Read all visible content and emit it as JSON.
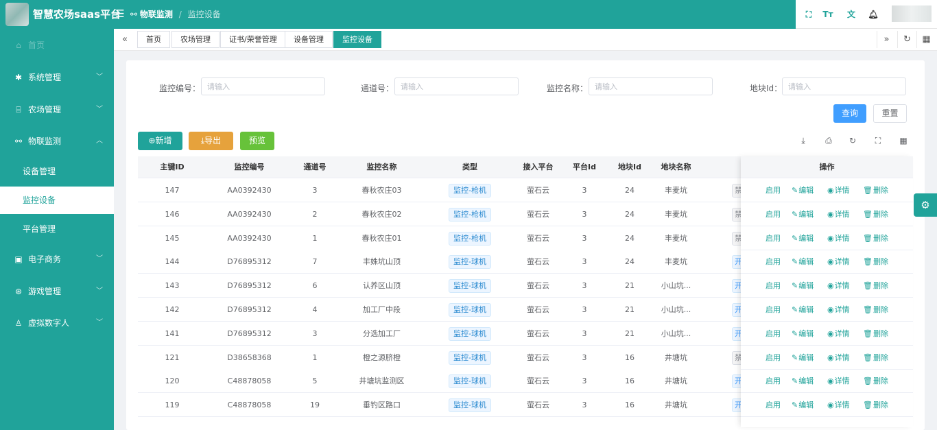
{
  "app": {
    "title": "智慧农场saas平台"
  },
  "header": {
    "breadcrumb": [
      "物联监测",
      "监控设备"
    ],
    "icons": [
      "fullscreen-icon",
      "font-size-icon",
      "translate-icon",
      "bell-icon"
    ]
  },
  "sidebar": {
    "home": "首页",
    "items": [
      {
        "label": "系统管理",
        "icon": "gear-icon",
        "expanded": false
      },
      {
        "label": "农场管理",
        "icon": "bank-icon",
        "expanded": false
      },
      {
        "label": "物联监测",
        "icon": "binoculars-icon",
        "expanded": true
      },
      {
        "label": "电子商务",
        "icon": "shop-icon",
        "expanded": false
      },
      {
        "label": "游戏管理",
        "icon": "game-icon",
        "expanded": false
      },
      {
        "label": "虚拟数字人",
        "icon": "user-icon",
        "expanded": false
      }
    ],
    "sub_items": [
      {
        "label": "设备管理",
        "active": false
      },
      {
        "label": "监控设备",
        "active": true
      },
      {
        "label": "平台管理",
        "active": false
      }
    ]
  },
  "tabs": [
    {
      "label": "首页",
      "active": false
    },
    {
      "label": "农场管理",
      "active": false
    },
    {
      "label": "证书/荣誉管理",
      "active": false
    },
    {
      "label": "设备管理",
      "active": false
    },
    {
      "label": "监控设备",
      "active": true
    }
  ],
  "search": {
    "fields": [
      {
        "label": "监控编号：",
        "placeholder": "请输入"
      },
      {
        "label": "通道号：",
        "placeholder": "请输入"
      },
      {
        "label": "监控名称：",
        "placeholder": "请输入"
      },
      {
        "label": "地块Id：",
        "placeholder": "请输入"
      }
    ],
    "query_label": "查询",
    "reset_label": "重置"
  },
  "toolbar": {
    "add_label": "新增",
    "export_label": "导出",
    "preview_label": "预览",
    "tools": [
      "download-icon",
      "print-icon",
      "refresh-icon",
      "fullscreen-icon",
      "columns-icon"
    ]
  },
  "table": {
    "columns": [
      "主键ID",
      "监控编号",
      "通道号",
      "监控名称",
      "类型",
      "接入平台",
      "平台Id",
      "地块Id",
      "地块名称"
    ],
    "ops_header": "操作",
    "actions": [
      "启用",
      "编辑",
      "详情",
      "删除"
    ],
    "rows": [
      {
        "id": "147",
        "code": "AA0392430",
        "channel": "3",
        "name": "春秋农庄03",
        "type": "监控-枪机",
        "platform": "萤石云",
        "platform_id": "3",
        "plot_id": "24",
        "plot_name": "丰麦坑",
        "status": "禁"
      },
      {
        "id": "146",
        "code": "AA0392430",
        "channel": "2",
        "name": "春秋农庄02",
        "type": "监控-枪机",
        "platform": "萤石云",
        "platform_id": "3",
        "plot_id": "24",
        "plot_name": "丰麦坑",
        "status": "禁"
      },
      {
        "id": "145",
        "code": "AA0392430",
        "channel": "1",
        "name": "春秋农庄01",
        "type": "监控-枪机",
        "platform": "萤石云",
        "platform_id": "3",
        "plot_id": "24",
        "plot_name": "丰麦坑",
        "status": "禁"
      },
      {
        "id": "144",
        "code": "D76895312",
        "channel": "7",
        "name": "丰姝坑山顶",
        "type": "监控-球机",
        "platform": "萤石云",
        "platform_id": "3",
        "plot_id": "24",
        "plot_name": "丰麦坑",
        "status": "开"
      },
      {
        "id": "143",
        "code": "D76895312",
        "channel": "6",
        "name": "认养区山顶",
        "type": "监控-球机",
        "platform": "萤石云",
        "platform_id": "3",
        "plot_id": "21",
        "plot_name": "小山坑...",
        "status": "开"
      },
      {
        "id": "142",
        "code": "D76895312",
        "channel": "4",
        "name": "加工厂中段",
        "type": "监控-球机",
        "platform": "萤石云",
        "platform_id": "3",
        "plot_id": "21",
        "plot_name": "小山坑...",
        "status": "开"
      },
      {
        "id": "141",
        "code": "D76895312",
        "channel": "3",
        "name": "分选加工厂",
        "type": "监控-球机",
        "platform": "萤石云",
        "platform_id": "3",
        "plot_id": "21",
        "plot_name": "小山坑...",
        "status": "开"
      },
      {
        "id": "121",
        "code": "D38658368",
        "channel": "1",
        "name": "橙之源脐橙",
        "type": "监控-球机",
        "platform": "萤石云",
        "platform_id": "3",
        "plot_id": "16",
        "plot_name": "井塘坑",
        "status": "禁"
      },
      {
        "id": "120",
        "code": "C48878058",
        "channel": "5",
        "name": "井塘坑监测区",
        "type": "监控-球机",
        "platform": "萤石云",
        "platform_id": "3",
        "plot_id": "16",
        "plot_name": "井塘坑",
        "status": "开"
      },
      {
        "id": "119",
        "code": "C48878058",
        "channel": "19",
        "name": "垂钓区路口",
        "type": "监控-球机",
        "platform": "萤石云",
        "platform_id": "3",
        "plot_id": "16",
        "plot_name": "井塘坑",
        "status": "开"
      }
    ]
  },
  "colors": {
    "brand": "#20a39a",
    "primary": "#409eff",
    "warning": "#e6a23c",
    "success": "#67c23a"
  }
}
